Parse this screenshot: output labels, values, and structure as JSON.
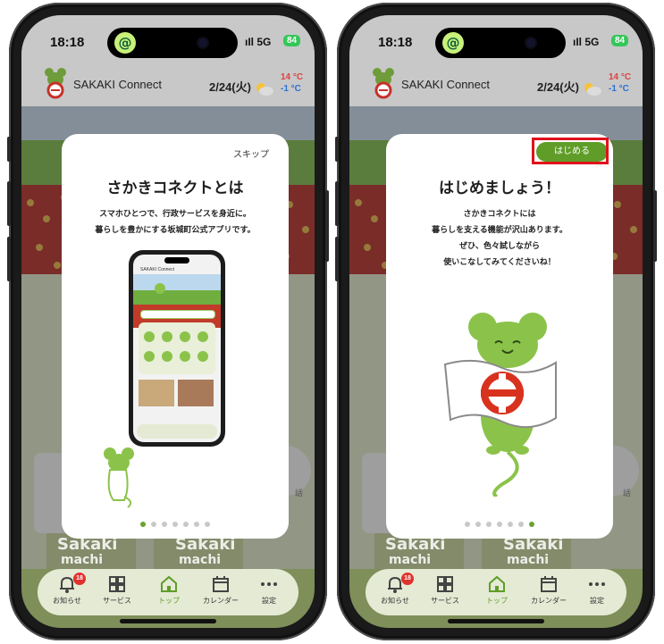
{
  "status_bar": {
    "time": "18:18",
    "signal": "5G",
    "battery": "84"
  },
  "app_header": {
    "title": "SAKAKI Connect",
    "date": "2/24(火)",
    "temp_high": "14 °C",
    "temp_low": "-1 °C",
    "weather_icon": "sun-cloud-icon"
  },
  "background": {
    "sakaki_text": "Sakaki",
    "machi_text": "machi",
    "side_label": "話"
  },
  "nav": {
    "items": [
      {
        "label": "お知らせ",
        "icon": "bell-icon",
        "badge": "18"
      },
      {
        "label": "サービス",
        "icon": "grid-icon"
      },
      {
        "label": "トップ",
        "icon": "home-icon",
        "active": true
      },
      {
        "label": "カレンダー",
        "icon": "calendar-icon"
      },
      {
        "label": "設定",
        "icon": "more-icon"
      }
    ]
  },
  "screen1": {
    "skip": "スキップ",
    "title": "さかきコネクトとは",
    "line1": "スマホひとつで、行政サービスを身近に。",
    "line2": "暮らしを豊かにする坂城町公式アプリです。",
    "preview_app_title": "SAKAKI Connect",
    "pagination": {
      "total": 7,
      "current": 1
    }
  },
  "screen2": {
    "start_button": "はじめる",
    "title": "はじめましょう！",
    "line1": "さかきコネクトには",
    "line2": "暮らしを支える機能が沢山あります。",
    "line3": "ぜひ、色々試しながら",
    "line4": "使いこなしてみてくださいね！",
    "pagination": {
      "total": 7,
      "current": 7
    }
  },
  "colors": {
    "accent": "#5f9d28",
    "highlight": "#e0121b",
    "mascot": "#8bc34a"
  }
}
